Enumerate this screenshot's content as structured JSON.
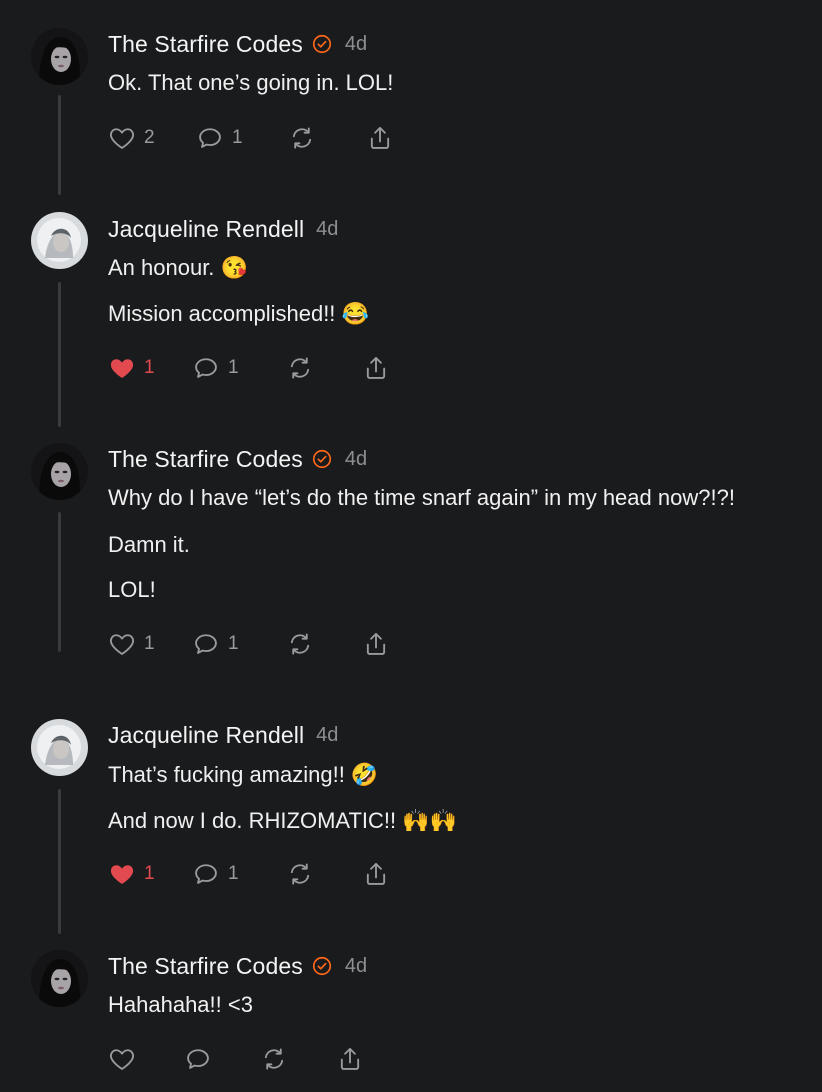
{
  "comments": [
    {
      "author": "The Starfire Codes",
      "verified": true,
      "time": "4d",
      "lines": [
        "Ok. That one’s going in. LOL!"
      ],
      "likes": "2",
      "replies": "1",
      "liked": false
    },
    {
      "author": "Jacqueline Rendell",
      "verified": false,
      "time": "4d",
      "lines": [
        "An honour. 😘",
        "Mission accomplished!! 😂"
      ],
      "likes": "1",
      "replies": "1",
      "liked": true
    },
    {
      "author": "The Starfire Codes",
      "verified": true,
      "time": "4d",
      "lines": [
        "Why do I have “let’s do the time snarf again” in my head now?!?!",
        "Damn it.",
        "LOL!"
      ],
      "likes": "1",
      "replies": "1",
      "liked": false
    },
    {
      "author": "Jacqueline Rendell",
      "verified": false,
      "time": "4d",
      "lines": [
        "That’s fucking amazing!! 🤣",
        "And now I do. RHIZOMATIC!! 🙌🙌"
      ],
      "likes": "1",
      "replies": "1",
      "liked": true
    },
    {
      "author": "The Starfire Codes",
      "verified": true,
      "time": "4d",
      "lines": [
        "Hahahaha!! <3"
      ],
      "likes": "",
      "replies": "",
      "liked": false
    }
  ],
  "colors": {
    "background": "#1a1b1d",
    "verified_accent": "#ff6719",
    "liked_heart": "#e24a4f",
    "muted": "#9a9b9f"
  },
  "icons": [
    "heart-icon",
    "comment-icon",
    "restack-icon",
    "share-icon",
    "verified-check-icon"
  ]
}
